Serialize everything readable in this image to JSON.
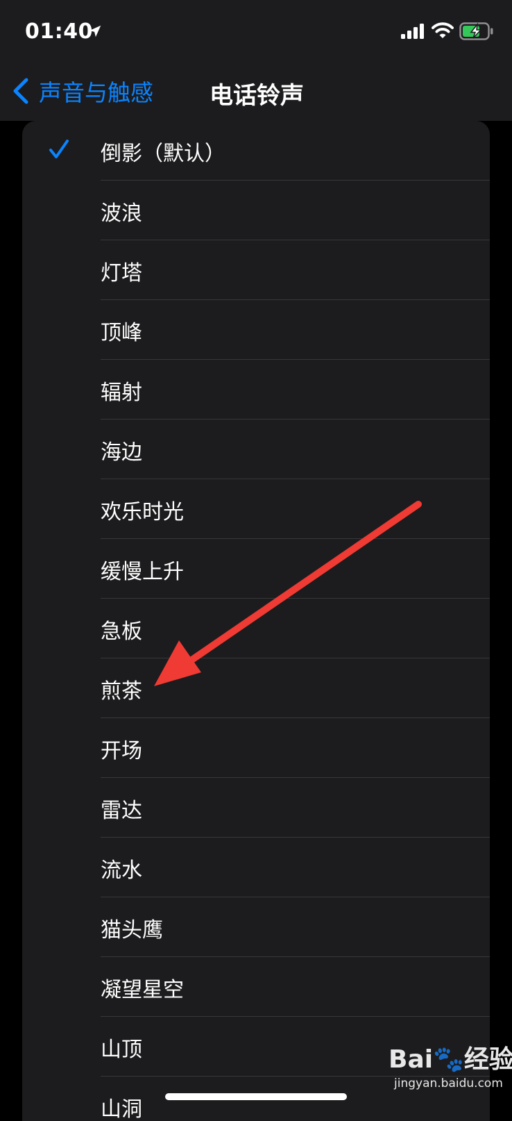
{
  "status_bar": {
    "time": "01:40",
    "icons": [
      "location-arrow-icon",
      "cellular-signal-icon",
      "wifi-icon",
      "battery-charging-icon"
    ]
  },
  "nav": {
    "back_label": "声音与触感",
    "title": "电话铃声"
  },
  "ringtones": [
    {
      "label": "倒影（默认）",
      "selected": true
    },
    {
      "label": "波浪",
      "selected": false
    },
    {
      "label": "灯塔",
      "selected": false
    },
    {
      "label": "顶峰",
      "selected": false
    },
    {
      "label": "辐射",
      "selected": false
    },
    {
      "label": "海边",
      "selected": false
    },
    {
      "label": "欢乐时光",
      "selected": false
    },
    {
      "label": "缓慢上升",
      "selected": false
    },
    {
      "label": "急板",
      "selected": false
    },
    {
      "label": "煎茶",
      "selected": false
    },
    {
      "label": "开场",
      "selected": false
    },
    {
      "label": "雷达",
      "selected": false
    },
    {
      "label": "流水",
      "selected": false
    },
    {
      "label": "猫头鹰",
      "selected": false
    },
    {
      "label": "凝望星空",
      "selected": false
    },
    {
      "label": "山顶",
      "selected": false
    },
    {
      "label": "山洞",
      "selected": false
    }
  ],
  "watermark": {
    "logo": "Bai🐾经验",
    "url": "jingyan.baidu.com"
  },
  "colors": {
    "accent": "#0a84ff",
    "background": "#000000",
    "card": "#1c1c1e",
    "annotation_arrow": "#f03a34",
    "battery": "#34c759"
  }
}
